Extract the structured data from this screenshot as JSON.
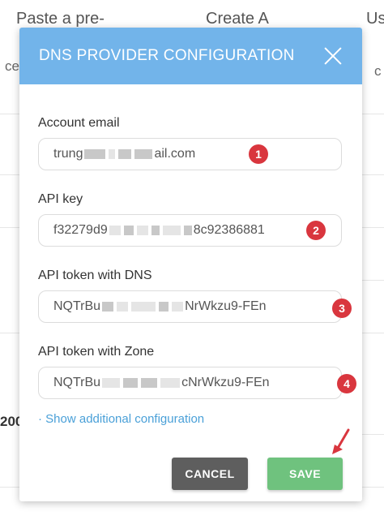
{
  "background": {
    "col1_header": "Paste a pre-",
    "col2_header": "Create A",
    "col3_header": "Us",
    "row_fragment_left": "ce",
    "row_fragment_right": "c",
    "row_number_fragment": "200"
  },
  "dialog": {
    "title": "DNS PROVIDER CONFIGURATION",
    "fields": [
      {
        "label": "Account email",
        "value_start": "trung",
        "value_end": "ail.com",
        "badge": "1"
      },
      {
        "label": "API key",
        "value_start": "f32279d9",
        "value_end": "8c92386881",
        "badge": "2"
      },
      {
        "label": "API token with DNS",
        "value_start": "NQTrBu",
        "value_end": "NrWkzu9-FEn",
        "badge": "3"
      },
      {
        "label": "API token with Zone",
        "value_start": "NQTrBu",
        "value_end": "cNrWkzu9-FEn",
        "badge": "4"
      }
    ],
    "link": "· Show additional configuration",
    "cancel_label": "CANCEL",
    "save_label": "SAVE"
  },
  "colors": {
    "header": "#72b4ea",
    "badge": "#d9363e",
    "cancel": "#5e5e5e",
    "save": "#6fc27e",
    "link": "#4aa0d8"
  }
}
